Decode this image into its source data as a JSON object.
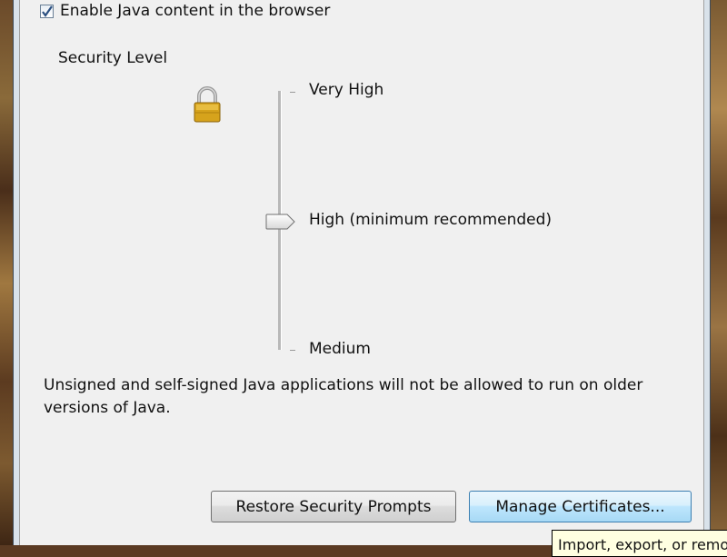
{
  "enable_checkbox": {
    "label": "Enable Java content in the browser",
    "checked": true
  },
  "security": {
    "heading": "Security Level",
    "levels": [
      "Very High",
      "High (minimum recommended)",
      "Medium"
    ],
    "selected": "High (minimum recommended)",
    "description": "Unsigned and self-signed Java applications will not be allowed to run on older versions of Java."
  },
  "buttons": {
    "restore": "Restore Security Prompts",
    "manage": "Manage Certificates..."
  },
  "tooltip": {
    "text": "Import, export, or remove certificates"
  },
  "icons": {
    "lock": "padlock-icon",
    "checkmark": "checkmark-icon"
  },
  "colors": {
    "panel": "#f0f0f0",
    "tooltip": "#ffffe1",
    "lock": "#d6a31c",
    "focus_button": "#bee6fd"
  }
}
